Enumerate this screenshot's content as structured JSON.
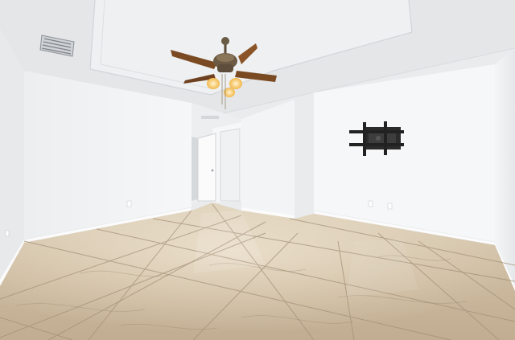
{
  "scene": {
    "subject": "empty-room-interior",
    "colors": {
      "ceiling": "#e6e8ea",
      "tray_ceiling": "#eff0f1",
      "left_wall": "#f2f3f4",
      "back_wall": "#f5f6f7",
      "right_wall": "#eef0f1",
      "floor_base": "#c9b79d",
      "floor_highlight": "#ddd0bb",
      "grout": "#a39077",
      "baseboard": "#fafafa",
      "fan_blade": "#7a4a22",
      "fan_bronze": "#6b5a44",
      "fan_light": "#ffd98a",
      "tv_mount": "#2a2a2a",
      "door": "#fbfbfb",
      "vent": "#7d8187"
    },
    "objects": [
      {
        "name": "ceiling-fan-icon"
      },
      {
        "name": "tv-wall-mount-icon"
      },
      {
        "name": "air-vent-icon"
      },
      {
        "name": "interior-door-icon"
      },
      {
        "name": "marble-tile-floor"
      }
    ]
  }
}
